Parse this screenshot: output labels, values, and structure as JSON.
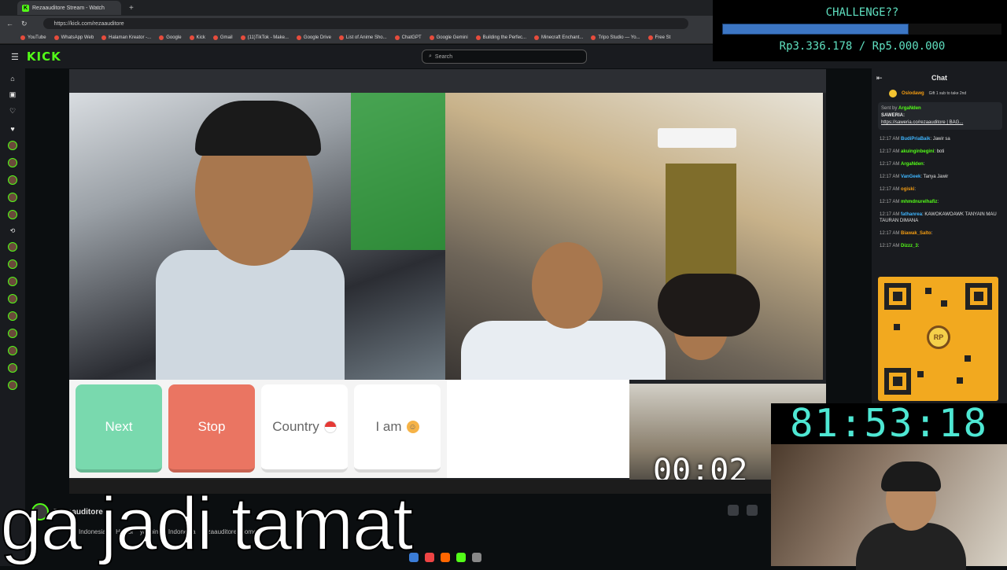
{
  "browser": {
    "tab_title": "Rezaauditore Stream - Watch",
    "url": "https://kick.com/rezaauditore",
    "bookmarks": [
      "YouTube",
      "WhatsApp Web",
      "Halaman Kreator -...",
      "Google",
      "Kick",
      "Gmail",
      "(11)TikTok - Make...",
      "Google Drive",
      "List of Anime Sho...",
      "ChatGPT",
      "Google Gemini",
      "Building the Perfec...",
      "Minecraft Enchant...",
      "Tripo Studio — Yo...",
      "Free St"
    ]
  },
  "kick": {
    "logo": "KICK",
    "search_placeholder": "Search"
  },
  "controls": {
    "next": "Next",
    "stop": "Stop",
    "country": "Country",
    "iam": "I am"
  },
  "small_timer": "00:02",
  "chat": {
    "title": "Chat",
    "gift_user": "Oslodawg",
    "gift_text": "Gift 1 sub to take 2nd",
    "pinned_by": "Sent by",
    "pinned_user": "ArgaNden",
    "pinned_label": "SAWERIA:",
    "pinned_link": "https://saweria.co/rezaauditore | BAG...",
    "messages": [
      {
        "time": "12:17 AM",
        "user": "BudiPriaBaik",
        "text": ": Jawir sa"
      },
      {
        "time": "12:17 AM",
        "user": "akuinginbegini",
        "text": ": boti"
      },
      {
        "time": "12:17 AM",
        "user": "ArgaNden",
        "text": ":"
      },
      {
        "time": "12:17 AM",
        "user": "VanGeek",
        "text": ": Tanya Jawir"
      },
      {
        "time": "12:17 AM",
        "user": "ogiski",
        "text": ":"
      },
      {
        "time": "12:17 AM",
        "user": "mhmdnurelhafiz",
        "text": ":"
      },
      {
        "time": "12:17 AM",
        "user": "fathanrea",
        "text": ": KAWOKAWOAWK TANYAIN MAU TAURAN DIMANA"
      },
      {
        "time": "12:17 AM",
        "user": "Biawak_Salto",
        "text": ":"
      },
      {
        "time": "12:17 AM",
        "user": "Dizzz_3",
        "text": ":"
      }
    ]
  },
  "challenge": {
    "title": "CHALLENGE??",
    "amount": "Rp3.336.178 / Rp5.000.000",
    "progress": 0.667
  },
  "big_timer": "81:53:18",
  "caption": "ga jadi tamat",
  "streamer": {
    "name": "Rezaauditore",
    "tags": [
      "Indonesian",
      "Horror",
      "yapping",
      "Indonesia",
      "rezaauditore",
      "jomok"
    ]
  }
}
